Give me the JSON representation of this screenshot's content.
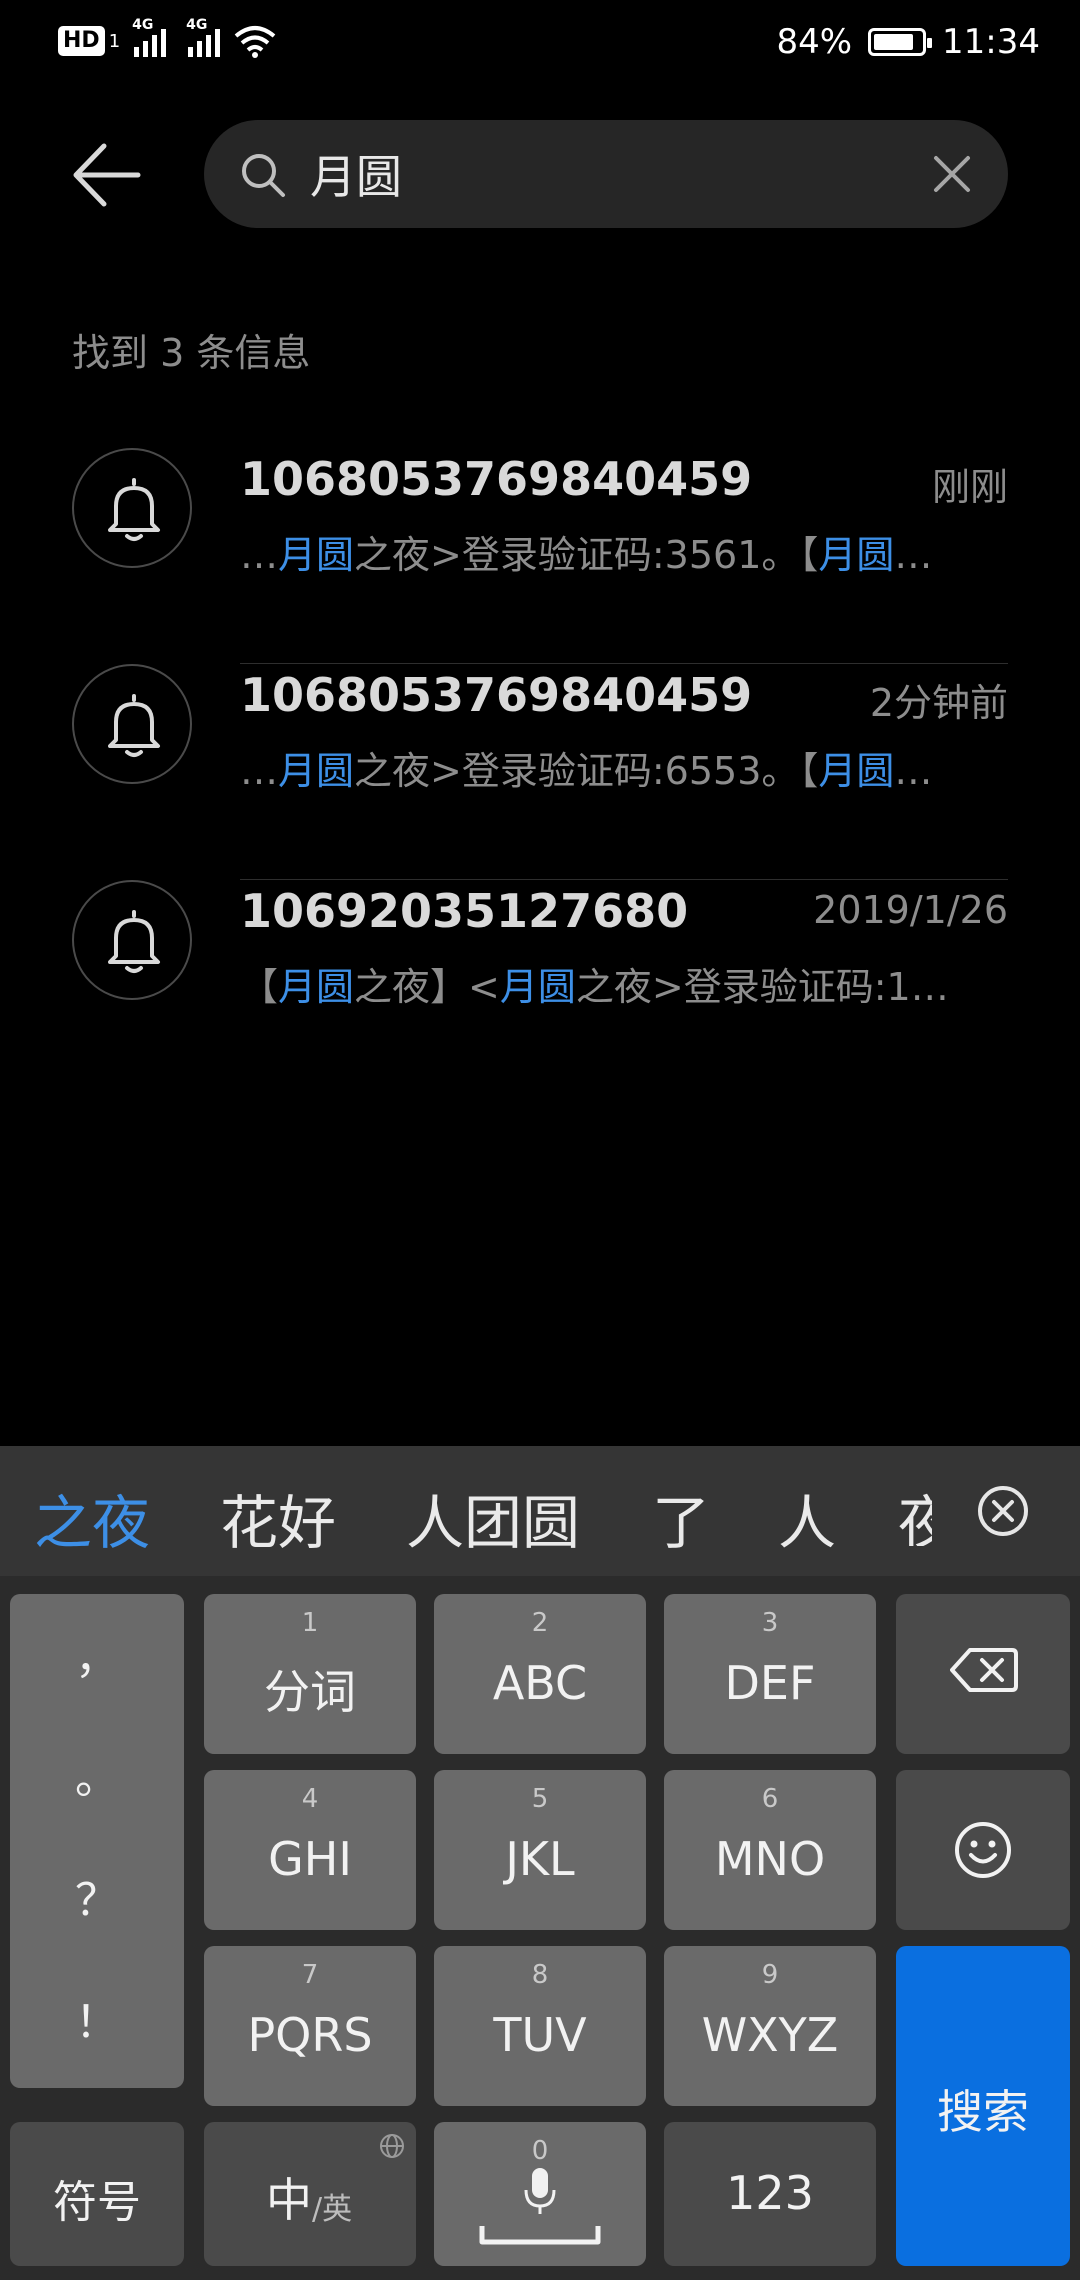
{
  "status_bar": {
    "hd": "HD",
    "hd_sub": "1",
    "network1": "4G",
    "network2": "4G",
    "battery": "84%",
    "battery_level": 0.84,
    "time": "11:34"
  },
  "search": {
    "value": "月圆",
    "placeholder": ""
  },
  "result_count": "找到 3 条信息",
  "results": [
    {
      "sender": "1068053769840459",
      "time": "刚刚",
      "snippet": [
        {
          "t": "…",
          "h": false
        },
        {
          "t": "月圆",
          "h": true
        },
        {
          "t": "之夜>登录验证码:3561。【",
          "h": false
        },
        {
          "t": "月圆",
          "h": true
        },
        {
          "t": "…",
          "h": false
        }
      ]
    },
    {
      "sender": "1068053769840459",
      "time": "2分钟前",
      "snippet": [
        {
          "t": "…",
          "h": false
        },
        {
          "t": "月圆",
          "h": true
        },
        {
          "t": "之夜>登录验证码:6553。【",
          "h": false
        },
        {
          "t": "月圆",
          "h": true
        },
        {
          "t": "…",
          "h": false
        }
      ]
    },
    {
      "sender": "10692035127680",
      "time": "2019/1/26",
      "snippet": [
        {
          "t": "【",
          "h": false
        },
        {
          "t": "月圆",
          "h": true
        },
        {
          "t": "之夜】<",
          "h": false
        },
        {
          "t": "月圆",
          "h": true
        },
        {
          "t": "之夜>登录验证码:1…",
          "h": false
        }
      ]
    }
  ],
  "keyboard": {
    "candidates": [
      "之夜",
      "花好",
      "人团圆",
      "了",
      "人",
      "夜"
    ],
    "punctuation": [
      "，",
      "。",
      "？",
      "！"
    ],
    "keys": [
      {
        "num": "1",
        "label": "分词"
      },
      {
        "num": "2",
        "label": "ABC"
      },
      {
        "num": "3",
        "label": "DEF"
      },
      {
        "num": "4",
        "label": "GHI"
      },
      {
        "num": "5",
        "label": "JKL"
      },
      {
        "num": "6",
        "label": "MNO"
      },
      {
        "num": "7",
        "label": "PQRS"
      },
      {
        "num": "8",
        "label": "TUV"
      },
      {
        "num": "9",
        "label": "WXYZ"
      }
    ],
    "symbols_label": "符号",
    "lang_main": "中",
    "lang_sub": "/英",
    "space_num": "0",
    "num_label": "123",
    "search_label": "搜索"
  },
  "colors": {
    "background": "#000000",
    "highlight": "#3d8fe6",
    "search_key": "#0a6fe0",
    "key": "#6a6a6a",
    "key_dark": "#4a4a4a"
  }
}
